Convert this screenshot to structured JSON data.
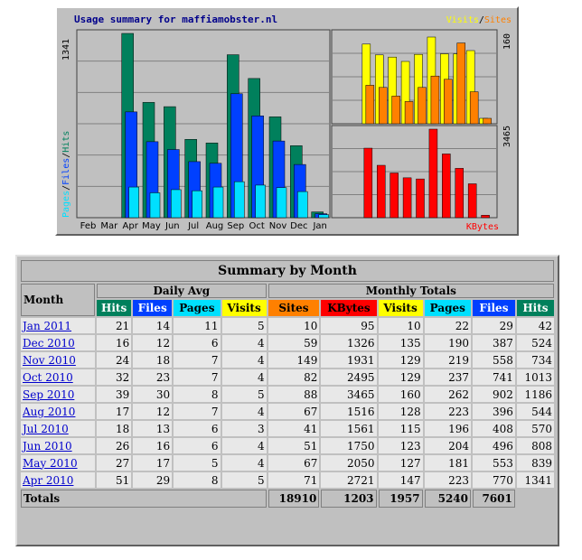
{
  "graph": {
    "title": "Usage summary for maffiamobster.nl",
    "legend_top": {
      "visits": "Visits",
      "sep": "/",
      "sites": "Sites"
    },
    "legend_bottom": "KBytes",
    "left_axis_max": "1341",
    "right_top_axis_max": "160",
    "right_bottom_axis_max": "3465",
    "left_legend": {
      "pages": "Pages",
      "files": "Files",
      "hits": "Hits",
      "sep": "/"
    },
    "colors": {
      "hits": "#00805c",
      "files": "#0040ff",
      "pages": "#00e0ff",
      "visits": "#ffff00",
      "sites": "#ff8000",
      "kbytes": "#ff0000"
    }
  },
  "chart_data": {
    "type": "bar",
    "categories": [
      "Feb",
      "Mar",
      "Apr",
      "May",
      "Jun",
      "Jul",
      "Aug",
      "Sep",
      "Oct",
      "Nov",
      "Dec",
      "Jan"
    ],
    "series": [
      {
        "name": "Hits",
        "values": [
          0,
          0,
          1341,
          839,
          808,
          570,
          544,
          1186,
          1013,
          734,
          524,
          42
        ]
      },
      {
        "name": "Files",
        "values": [
          0,
          0,
          770,
          553,
          496,
          408,
          396,
          902,
          741,
          558,
          387,
          29
        ]
      },
      {
        "name": "Pages",
        "values": [
          0,
          0,
          223,
          181,
          204,
          196,
          223,
          262,
          237,
          219,
          190,
          22
        ]
      },
      {
        "name": "Visits",
        "values": [
          0,
          0,
          147,
          127,
          123,
          115,
          128,
          160,
          129,
          129,
          135,
          10
        ]
      },
      {
        "name": "Sites",
        "values": [
          0,
          0,
          71,
          67,
          51,
          41,
          67,
          88,
          82,
          149,
          59,
          10
        ]
      },
      {
        "name": "KBytes",
        "values": [
          0,
          0,
          2721,
          2050,
          1750,
          1561,
          1516,
          3465,
          2495,
          1931,
          1326,
          95
        ]
      }
    ]
  },
  "summary": {
    "title": "Summary by Month",
    "month_label": "Month",
    "daily_avg_label": "Daily Avg",
    "monthly_totals_label": "Monthly Totals",
    "daily_cols": [
      "Hits",
      "Files",
      "Pages",
      "Visits"
    ],
    "monthly_cols": [
      "Sites",
      "KBytes",
      "Visits",
      "Pages",
      "Files",
      "Hits"
    ],
    "rows": [
      {
        "month": "Jan 2011",
        "d": [
          "21",
          "14",
          "11",
          "5"
        ],
        "m": [
          "10",
          "95",
          "10",
          "22",
          "29",
          "42"
        ]
      },
      {
        "month": "Dec 2010",
        "d": [
          "16",
          "12",
          "6",
          "4"
        ],
        "m": [
          "59",
          "1326",
          "135",
          "190",
          "387",
          "524"
        ]
      },
      {
        "month": "Nov 2010",
        "d": [
          "24",
          "18",
          "7",
          "4"
        ],
        "m": [
          "149",
          "1931",
          "129",
          "219",
          "558",
          "734"
        ]
      },
      {
        "month": "Oct 2010",
        "d": [
          "32",
          "23",
          "7",
          "4"
        ],
        "m": [
          "82",
          "2495",
          "129",
          "237",
          "741",
          "1013"
        ]
      },
      {
        "month": "Sep 2010",
        "d": [
          "39",
          "30",
          "8",
          "5"
        ],
        "m": [
          "88",
          "3465",
          "160",
          "262",
          "902",
          "1186"
        ]
      },
      {
        "month": "Aug 2010",
        "d": [
          "17",
          "12",
          "7",
          "4"
        ],
        "m": [
          "67",
          "1516",
          "128",
          "223",
          "396",
          "544"
        ]
      },
      {
        "month": "Jul 2010",
        "d": [
          "18",
          "13",
          "6",
          "3"
        ],
        "m": [
          "41",
          "1561",
          "115",
          "196",
          "408",
          "570"
        ]
      },
      {
        "month": "Jun 2010",
        "d": [
          "26",
          "16",
          "6",
          "4"
        ],
        "m": [
          "51",
          "1750",
          "123",
          "204",
          "496",
          "808"
        ]
      },
      {
        "month": "May 2010",
        "d": [
          "27",
          "17",
          "5",
          "4"
        ],
        "m": [
          "67",
          "2050",
          "127",
          "181",
          "553",
          "839"
        ]
      },
      {
        "month": "Apr 2010",
        "d": [
          "51",
          "29",
          "8",
          "5"
        ],
        "m": [
          "71",
          "2721",
          "147",
          "223",
          "770",
          "1341"
        ]
      }
    ],
    "totals_label": "Totals",
    "totals": [
      "18910",
      "1203",
      "1957",
      "5240",
      "7601"
    ]
  }
}
